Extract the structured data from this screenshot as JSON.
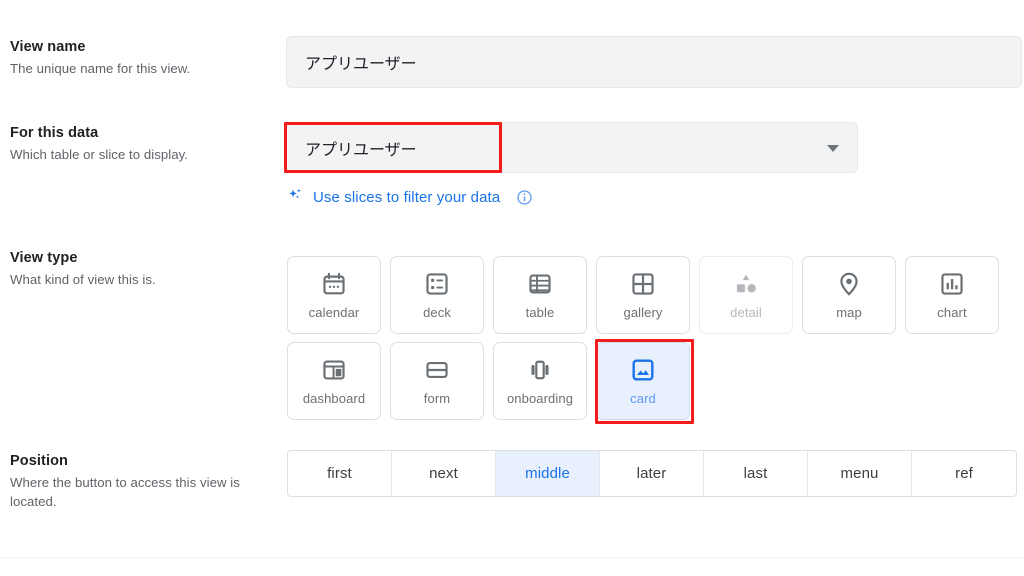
{
  "sections": {
    "view_name": {
      "title": "View name",
      "subtitle": "The unique name for this view.",
      "value": "アプリユーザー"
    },
    "for_this_data": {
      "title": "For this data",
      "subtitle": "Which table or slice to display.",
      "value": "アプリユーザー",
      "caret_icon": "chevron-down-icon",
      "slices_link": {
        "label": "Use slices to filter your data",
        "sparkle_icon": "sparkle-icon",
        "info_icon": "info-circle-icon",
        "color": "#1a73e8"
      }
    },
    "view_type": {
      "title": "View type",
      "subtitle": "What kind of view this is.",
      "selected": "card",
      "rows": [
        [
          {
            "label": "calendar",
            "icon": "calendar-icon",
            "state": "normal"
          },
          {
            "label": "deck",
            "icon": "deck-icon",
            "state": "normal"
          },
          {
            "label": "table",
            "icon": "table-icon",
            "state": "normal"
          },
          {
            "label": "gallery",
            "icon": "gallery-icon",
            "state": "normal"
          },
          {
            "label": "detail",
            "icon": "detail-icon",
            "state": "disabled"
          },
          {
            "label": "map",
            "icon": "map-pin-icon",
            "state": "normal"
          },
          {
            "label": "chart",
            "icon": "chart-icon",
            "state": "normal"
          }
        ],
        [
          {
            "label": "dashboard",
            "icon": "dashboard-icon",
            "state": "normal"
          },
          {
            "label": "form",
            "icon": "form-icon",
            "state": "normal"
          },
          {
            "label": "onboarding",
            "icon": "onboarding-icon",
            "state": "normal"
          },
          {
            "label": "card",
            "icon": "card-image-icon",
            "state": "selected"
          }
        ]
      ]
    },
    "position": {
      "title": "Position",
      "subtitle": "Where the button to access this view is located.",
      "selected": "middle",
      "options": [
        "first",
        "next",
        "middle",
        "later",
        "last",
        "menu",
        "ref"
      ]
    }
  },
  "annotations": {
    "highlight_color": "#f31b1b",
    "boxes": [
      "for-this-data-select",
      "view-type-card-tile"
    ]
  },
  "theme": {
    "accent": "#1a73e8",
    "selected_bg": "#e8f0fe",
    "field_bg": "#f1f3f4",
    "text": "#202124",
    "muted_text": "#5f6368"
  }
}
